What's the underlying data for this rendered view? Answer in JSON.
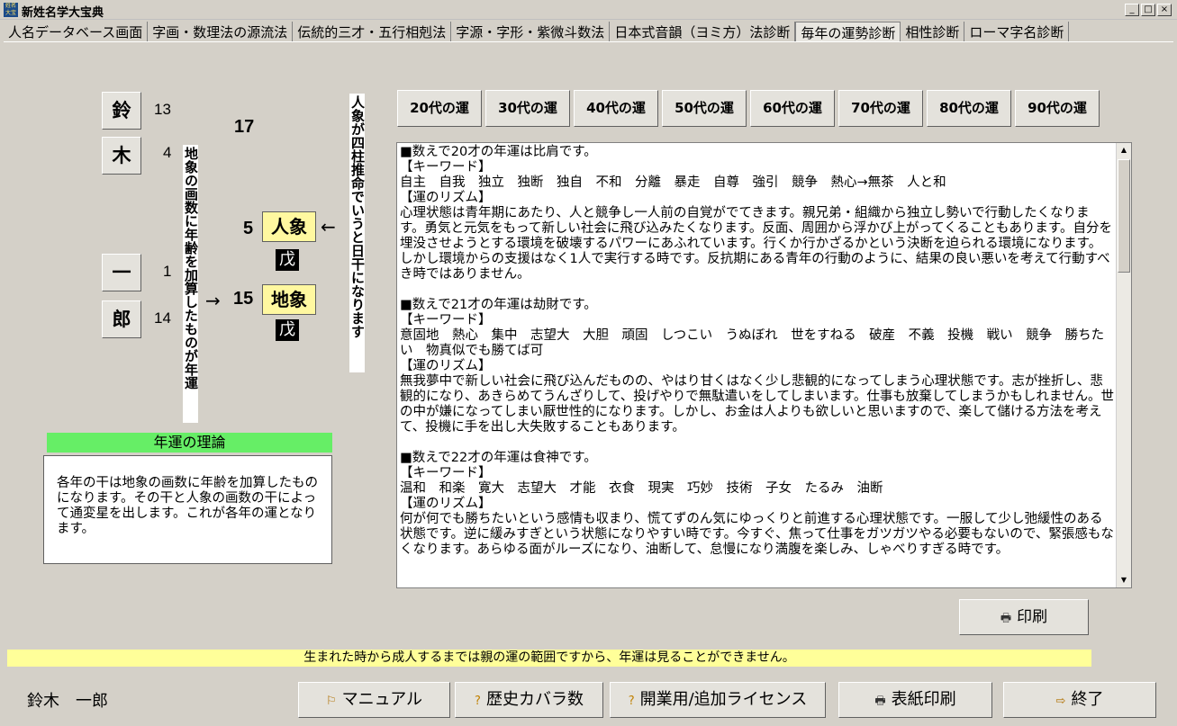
{
  "window": {
    "title": "新姓名学大宝典",
    "icon_text": "姓名大宝"
  },
  "tabs": [
    {
      "label": "人名データベース画面"
    },
    {
      "label": "字画・数理法の源流法"
    },
    {
      "label": "伝統的三才・五行相剋法"
    },
    {
      "label": "字源・字形・紫微斗数法"
    },
    {
      "label": "日本式音韻（ヨミ方）法診断"
    },
    {
      "label": "毎年の運勢診断",
      "active": true
    },
    {
      "label": "相性診断"
    },
    {
      "label": "ローマ字名診断"
    }
  ],
  "name_chart": {
    "chars": [
      {
        "char": "鈴",
        "strokes": "13"
      },
      {
        "char": "木",
        "strokes": "4"
      },
      {
        "char": "一",
        "strokes": "1"
      },
      {
        "char": "郎",
        "strokes": "14"
      }
    ],
    "total": "17",
    "jinkaku_num": "5",
    "jinkaku_label": "人象",
    "jinkaku_stem": "戊",
    "chikaku_num": "15",
    "chikaku_label": "地象",
    "chikaku_stem": "戊",
    "arrow_left": "←",
    "arrow_right": "→",
    "vertical_left": "地象の画数に年齢を加算したものが年運",
    "vertical_right": "人象が四柱推命でいうと日干になります"
  },
  "theory": {
    "title": "年運の理論",
    "body": "各年の干は地象の画数に年齢を加算したものになります。その干と人象の画数の干によって通変星を出します。これが各年の運となります。"
  },
  "age_buttons": [
    "20代の運",
    "30代の運",
    "40代の運",
    "50代の運",
    "60代の運",
    "70代の運",
    "80代の運",
    "90代の運"
  ],
  "fortune_text": {
    "sections": [
      {
        "heading": "■数えで20才の年運は比肩です。",
        "kw_label": "【キーワード】",
        "keywords": "自主　自我　独立　独断　独自　不和　分離　暴走　自尊　強引　競争　熱心→無茶　人と和",
        "rhythm_label": "【運のリズム】",
        "rhythm": "心理状態は青年期にあたり、人と競争し一人前の自覚がでてきます。親兄弟・組織から独立し勢いで行動したくなります。勇気と元気をもって新しい社会に飛び込みたくなります。反面、周囲から浮かび上がってくることもあります。自分を埋没させようとする環境を破壊するパワーにあふれています。行くか行かざるかという決断を迫られる環境になります。しかし環境からの支援はなく1人で実行する時です。反抗期にある青年の行動のように、結果の良い悪いを考えて行動すべき時ではありません。"
      },
      {
        "heading": "■数えで21才の年運は劫財です。",
        "kw_label": "【キーワード】",
        "keywords": "意固地　熱心　集中　志望大　大胆　頑固　しつこい　うぬぼれ　世をすねる　破産　不義　投機　戦い　競争　勝ちたい　物真似でも勝てば可",
        "rhythm_label": "【運のリズム】",
        "rhythm": "無我夢中で新しい社会に飛び込んだものの、やはり甘くはなく少し悲観的になってしまう心理状態です。志が挫折し、悲観的になり、あきらめてうんざりして、投げやりで無駄遣いをしてしまいます。仕事も放棄してしまうかもしれません。世の中が嫌になってしまい厭世性的になります。しかし、お金は人よりも欲しいと思いますので、楽して儲ける方法を考えて、投機に手を出し大失敗することもあります。"
      },
      {
        "heading": "■数えで22才の年運は食神です。",
        "kw_label": "【キーワード】",
        "keywords": "温和　和楽　寛大　志望大　才能　衣食　現実　巧妙　技術　子女　たるみ　油断",
        "rhythm_label": "【運のリズム】",
        "rhythm": "何が何でも勝ちたいという感情も収まり、慌てずのん気にゆっくりと前進する心理状態です。一服して少し弛緩性のある状態です。逆に緩みすぎという状態になりやすい時です。今すぐ、焦って仕事をガツガツやる必要もないので、緊張感もなくなります。あらゆる面がルーズになり、油断して、怠慢になり満腹を楽しみ、しゃべりすぎる時です。"
      }
    ]
  },
  "print_button": "印刷",
  "notice": "生まれた時から成人するまでは親の運の範囲ですから、年運は見ることができません。",
  "user_name": "鈴木　一郎",
  "bottom_buttons": {
    "manual": "マニュアル",
    "history": "歴史カバラ数",
    "license": "開業用/追加ライセンス",
    "cover_print": "表紙印刷",
    "exit": "終了"
  },
  "icons": {
    "print": "printer-icon",
    "manual": "manual-icon",
    "help": "question-icon",
    "exit": "exit-icon"
  }
}
